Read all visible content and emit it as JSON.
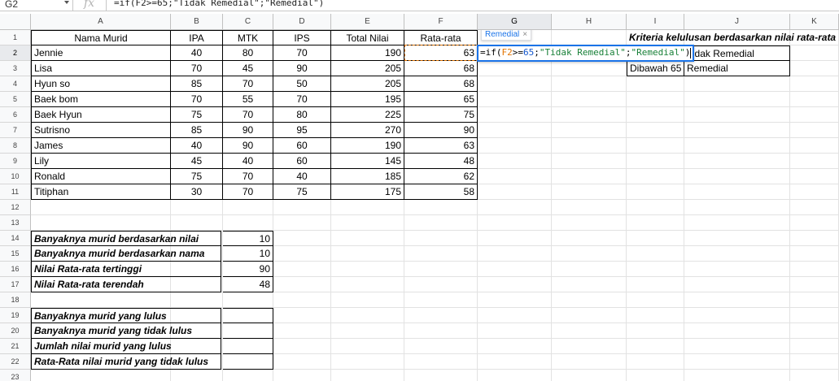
{
  "formula_bar": {
    "name_box": "G2",
    "fx": "fx",
    "formula": "=if(F2>=65;\"Tidak Remedial\";\"Remedial\")"
  },
  "columns": [
    "A",
    "B",
    "C",
    "D",
    "E",
    "F",
    "G",
    "H",
    "I",
    "J",
    "K"
  ],
  "rows": [
    "1",
    "2",
    "3",
    "4",
    "5",
    "6",
    "7",
    "8",
    "9",
    "10",
    "11",
    "12",
    "13",
    "14",
    "15",
    "16",
    "17",
    "18",
    "19",
    "20",
    "21",
    "22",
    "23"
  ],
  "table": {
    "headers": [
      "Nama Murid",
      "IPA",
      "MTK",
      "IPS",
      "Total Nilai",
      "Rata-rata"
    ],
    "records": [
      [
        "Jennie",
        "40",
        "80",
        "70",
        "190",
        "63"
      ],
      [
        "Lisa",
        "70",
        "45",
        "90",
        "205",
        "68"
      ],
      [
        "Hyun so",
        "85",
        "70",
        "50",
        "205",
        "68"
      ],
      [
        "Baek bom",
        "70",
        "55",
        "70",
        "195",
        "65"
      ],
      [
        "Baek Hyun",
        "75",
        "70",
        "80",
        "225",
        "75"
      ],
      [
        "Sutrisno",
        "85",
        "90",
        "95",
        "270",
        "90"
      ],
      [
        "James",
        "40",
        "90",
        "60",
        "190",
        "63"
      ],
      [
        "Lily",
        "45",
        "40",
        "60",
        "145",
        "48"
      ],
      [
        "Ronald",
        "75",
        "70",
        "40",
        "185",
        "62"
      ],
      [
        "Titiphan",
        "30",
        "70",
        "75",
        "175",
        "58"
      ]
    ]
  },
  "criteria": {
    "title": "Kriteria kelulusan berdasarkan nilai rata-rata",
    "rows": [
      {
        "label": "",
        "value": "Tidak Remedial"
      },
      {
        "label": "Dibawah 65",
        "value": "Remedial"
      }
    ]
  },
  "summary1": [
    {
      "label": "Banyaknya murid berdasarkan nilai",
      "value": "10"
    },
    {
      "label": "Banyaknya murid berdasarkan nama",
      "value": "10"
    },
    {
      "label": "Nilai Rata-rata tertinggi",
      "value": "90"
    },
    {
      "label": "Nilai Rata-rata terendah",
      "value": "48"
    }
  ],
  "summary2": [
    {
      "label": "Banyaknya murid yang lulus",
      "value": ""
    },
    {
      "label": "Banyaknya murid yang tidak lulus",
      "value": ""
    },
    {
      "label": "Jumlah nilai murid yang lulus",
      "value": ""
    },
    {
      "label": "Rata-Rata nilai murid yang tidak lulus",
      "value": ""
    }
  ],
  "editor": {
    "tooltip": "Remedial",
    "tooltip_close": "×",
    "parts": [
      "=if(",
      "F2",
      ">=",
      "65",
      ";",
      "\"Tidak Remedial\"",
      ";",
      "\"Remedial\"",
      ")"
    ]
  },
  "colors": {
    "selection": "#1a73e8",
    "ref": "#e37400",
    "number": "#1155cc",
    "string": "#188038"
  }
}
